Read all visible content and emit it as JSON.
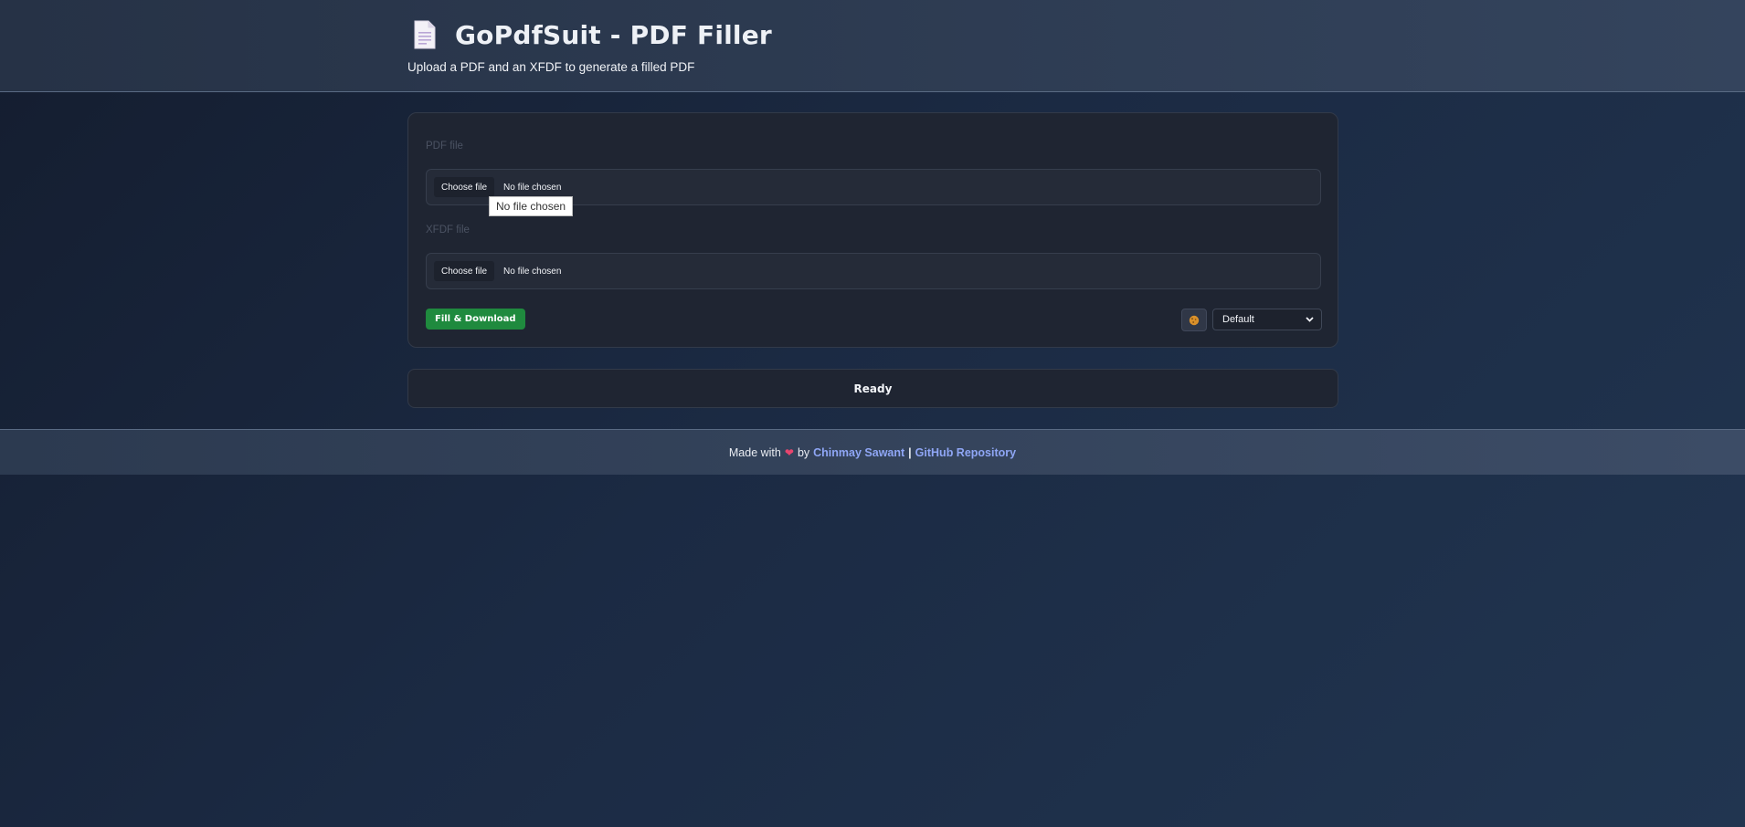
{
  "header": {
    "title": "GoPdfSuit - PDF Filler",
    "subtitle": "Upload a PDF and an XFDF to generate a filled PDF"
  },
  "form": {
    "pdf_label": "PDF file",
    "pdf_button": "Choose file",
    "pdf_status": "No file chosen",
    "pdf_tooltip": "No file chosen",
    "xfdf_label": "XFDF file",
    "xfdf_button": "Choose file",
    "xfdf_status": "No file chosen",
    "fill_button": "Fill & Download",
    "theme_icon": "cookie-icon",
    "theme_value": "Default"
  },
  "status": {
    "text": "Ready"
  },
  "footer": {
    "made_with": "Made with",
    "by": "by",
    "author": "Chinmay Sawant",
    "separator": "|",
    "repo_link": "GitHub Repository"
  },
  "colors": {
    "primary_button": "#1f8a3e",
    "link": "#8fa6f5",
    "heart": "#e8456e"
  }
}
